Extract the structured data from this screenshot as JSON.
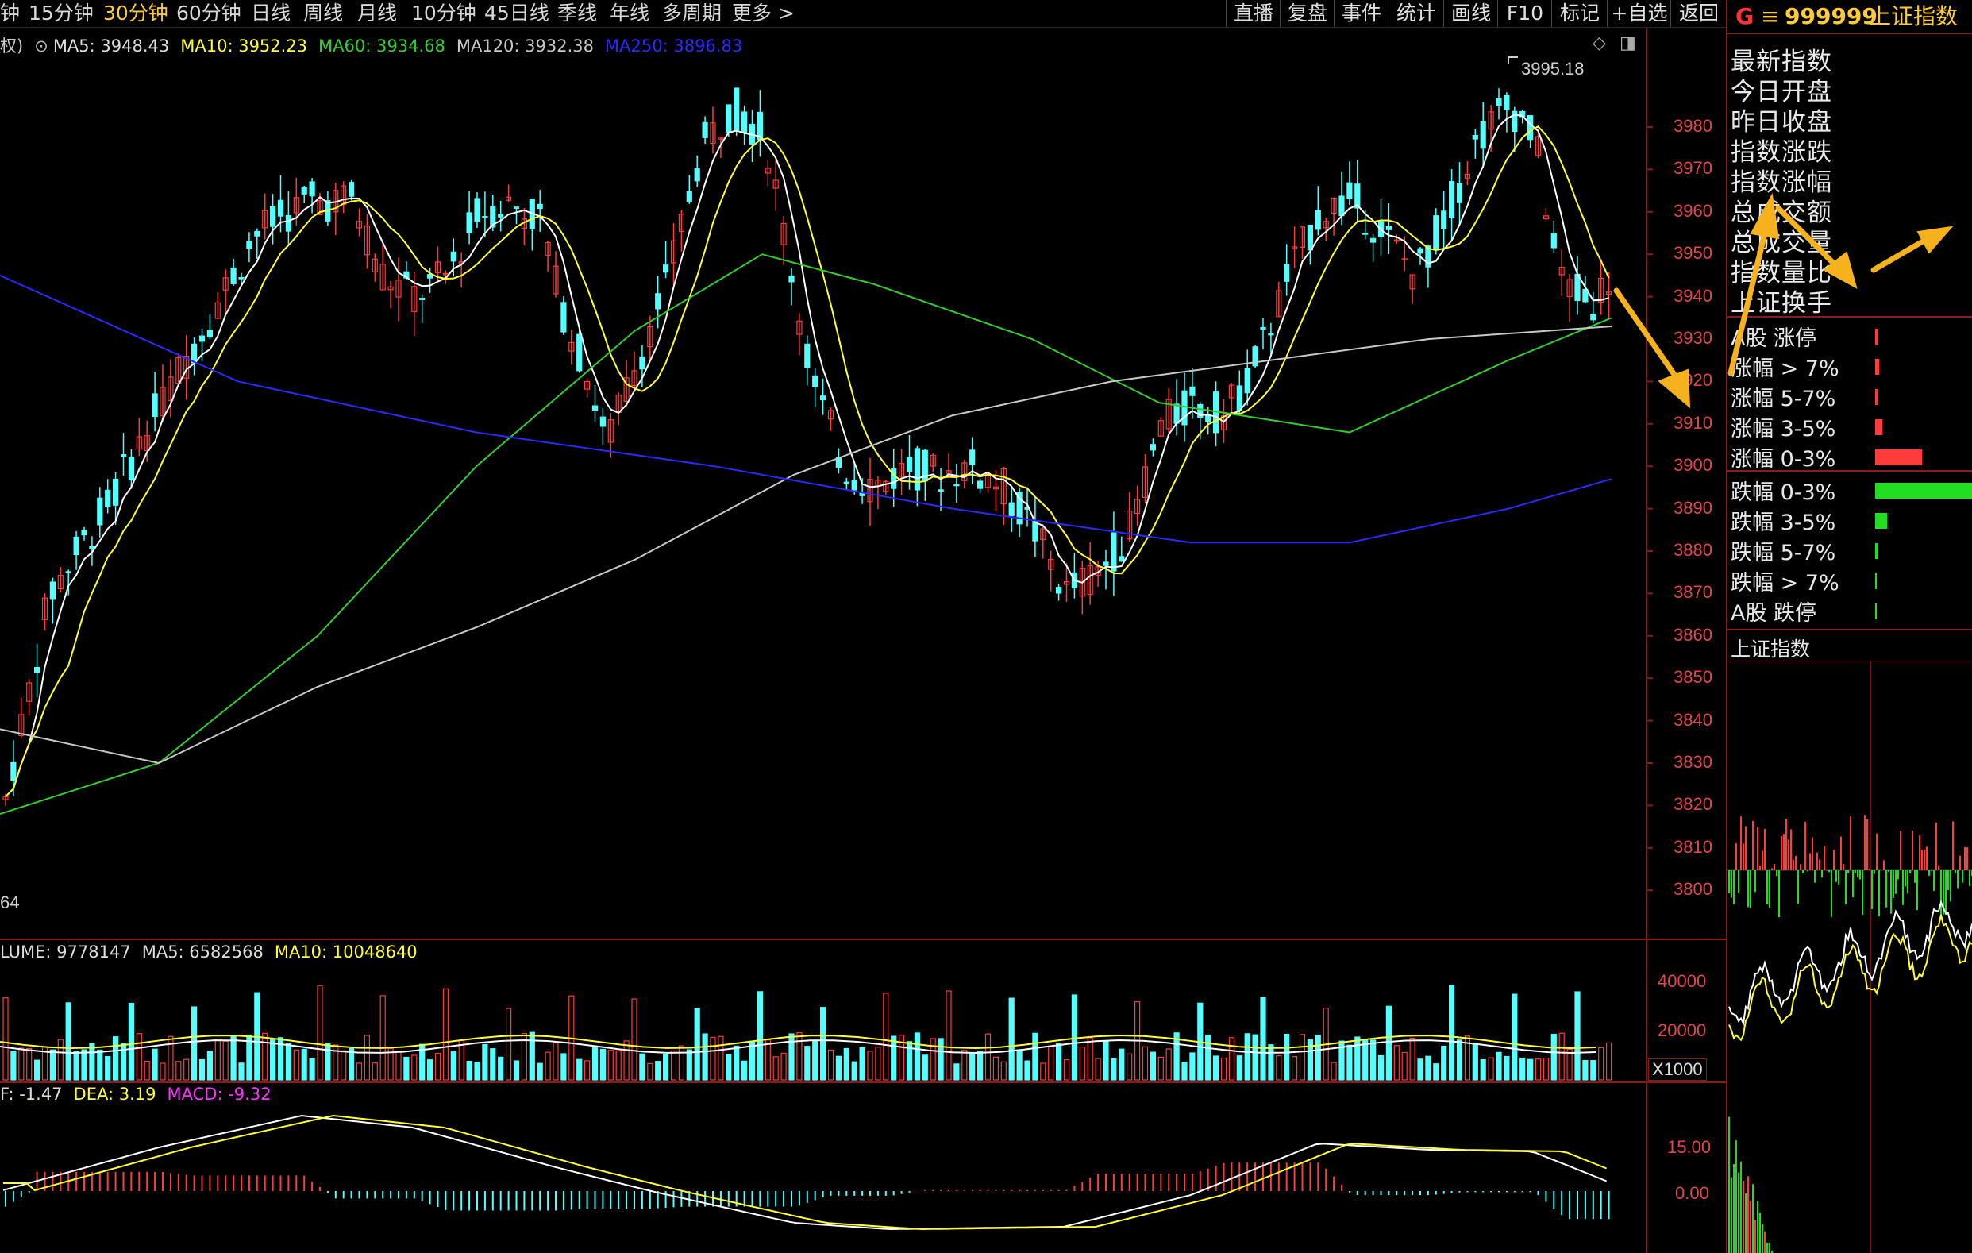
{
  "toolbar": {
    "periods": [
      "钟",
      "15分钟",
      "30分钟",
      "60分钟",
      "日线",
      "周线",
      "月线",
      "10分钟",
      "45日线",
      "季线",
      "年线",
      "多周期",
      "更多 >"
    ],
    "active_period": "30分钟",
    "right_buttons": [
      "直播",
      "复盘",
      "事件",
      "统计",
      "画线",
      "F10",
      "标记",
      "+自选",
      "返回"
    ]
  },
  "main_legend": {
    "prefix": "权)",
    "ma5": "MA5: 3948.43",
    "ma10": "MA10: 3952.23",
    "ma60": "MA60: 3934.68",
    "ma120": "MA120: 3932.38",
    "ma250": "MA250: 3896.83",
    "high_label": "3995.18",
    "bottom_left": "64"
  },
  "price_axis": [
    "3980",
    "3970",
    "3960",
    "3950",
    "3940",
    "3930",
    "3920",
    "3910",
    "3900",
    "3890",
    "3880",
    "3870",
    "3860",
    "3850",
    "3840",
    "3830",
    "3820",
    "3810",
    "3800"
  ],
  "volume_legend": {
    "vol": "LUME: 9778147",
    "ma5": "MA5: 6582568",
    "ma10": "MA10: 10048640",
    "axis": [
      "40000",
      "20000"
    ],
    "unit": "X1000"
  },
  "macd_legend": {
    "dif": "F: -1.47",
    "dea": "DEA: 3.19",
    "macd": "MACD: -9.32",
    "axis": [
      "15.00",
      "0.00"
    ]
  },
  "right_panel": {
    "logo": "G",
    "menu_icon": "≡",
    "code": "999999",
    "name": "上证指数",
    "index_rows": [
      "最新指数",
      "今日开盘",
      "昨日收盘",
      "指数涨跌",
      "指数涨幅",
      "总成交额",
      "总成交量",
      "指数量比",
      "上证换手"
    ],
    "up_rows": [
      "A股 涨停",
      "涨幅 > 7%",
      "涨幅 5-7%",
      "涨幅 3-5%",
      "涨幅 0-3%"
    ],
    "down_rows": [
      "跌幅 0-3%",
      "跌幅 3-5%",
      "跌幅 5-7%",
      "跌幅 > 7%",
      "A股 跌停"
    ],
    "up_bars": [
      0.02,
      0.03,
      0.02,
      0.05,
      0.33
    ],
    "down_bars": [
      1.0,
      0.12,
      0.03,
      0.01,
      0.01
    ],
    "mini_title": "上证指数"
  },
  "colors": {
    "up": "#ff3b3b",
    "down": "#54ffff",
    "ma5": "#ffffff",
    "ma10": "#ffff33",
    "ma60": "#33cc33",
    "ma120": "#c8c8c8",
    "ma250": "#2a2aff",
    "annotation": "#f5b21d",
    "panel_border": "#8b1a1a"
  }
}
